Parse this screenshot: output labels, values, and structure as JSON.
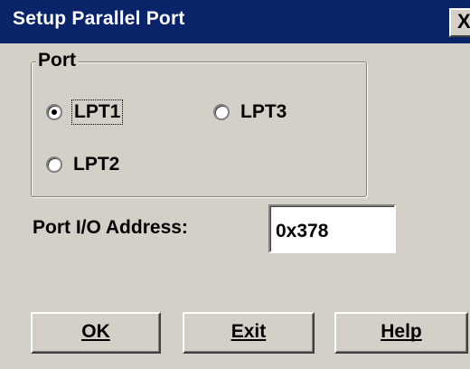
{
  "window": {
    "title": "Setup Parallel Port",
    "close_label": "X"
  },
  "port_group": {
    "legend": "Port",
    "options": [
      {
        "label": "LPT1",
        "checked": true
      },
      {
        "label": "LPT3",
        "checked": false
      },
      {
        "label": "LPT2",
        "checked": false
      }
    ]
  },
  "address": {
    "label": "Port I/O Address:",
    "value": "0x378"
  },
  "buttons": {
    "ok": {
      "mnemonic": "O",
      "rest": "K"
    },
    "exit": {
      "mnemonic": "E",
      "rest": "xit"
    },
    "help": {
      "mnemonic": "H",
      "rest": "elp"
    }
  },
  "colors": {
    "title_bar": "#0a246a",
    "face": "#d4d0c8"
  }
}
